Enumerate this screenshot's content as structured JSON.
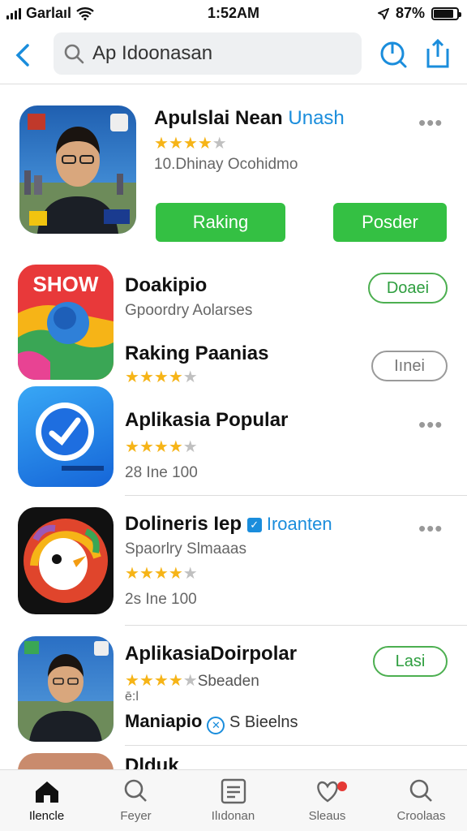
{
  "status": {
    "carrier": "Garlaıl",
    "time": "1:52AM",
    "battery": "87%",
    "battery_level": 0.87
  },
  "search": {
    "query": "Ap Idoonasan"
  },
  "featured": {
    "title": "Apulslai Nean",
    "tag": "Unash",
    "stars": 4,
    "subtitle": "10.Dhinay Ocohidmo",
    "btn1": "Raking",
    "btn2": "Posder"
  },
  "rows": [
    {
      "title": "Doakipio",
      "subtitle": "Gpoordry Aolarses",
      "button": "Doaei",
      "icon_text": "SHOW"
    },
    {
      "title": "Raking Paanias",
      "stars": 3.5,
      "button": "Iınei"
    },
    {
      "title": "Aplikasia Popular",
      "stars": 4,
      "subtitle": "28 Ine 100"
    },
    {
      "title": "Dolineris Iep",
      "tag": "Iroanten",
      "subtitle": "Spaorlry Slmaaas",
      "stars": 4,
      "meta": "2s Ine 100"
    },
    {
      "title": "AplikasiaDoirpolar",
      "stars": 4,
      "stars_suffix": "Sbeaden",
      "meta": "ē:l",
      "line2": "Maniapio",
      "line2_suffix": "S Bieelns",
      "button": "Lasi"
    },
    {
      "title": "Dlduk"
    }
  ],
  "tabs": [
    {
      "label": "Ilencle",
      "icon": "home-icon"
    },
    {
      "label": "Feyer",
      "icon": "search-icon"
    },
    {
      "label": "Ilıdonan",
      "icon": "list-icon"
    },
    {
      "label": "Sleaus",
      "icon": "heart-search-icon"
    },
    {
      "label": "Croolaas",
      "icon": "search-icon"
    }
  ],
  "colors": {
    "accent": "#1a8ddc",
    "green": "#34c043",
    "star": "#f6b417"
  }
}
